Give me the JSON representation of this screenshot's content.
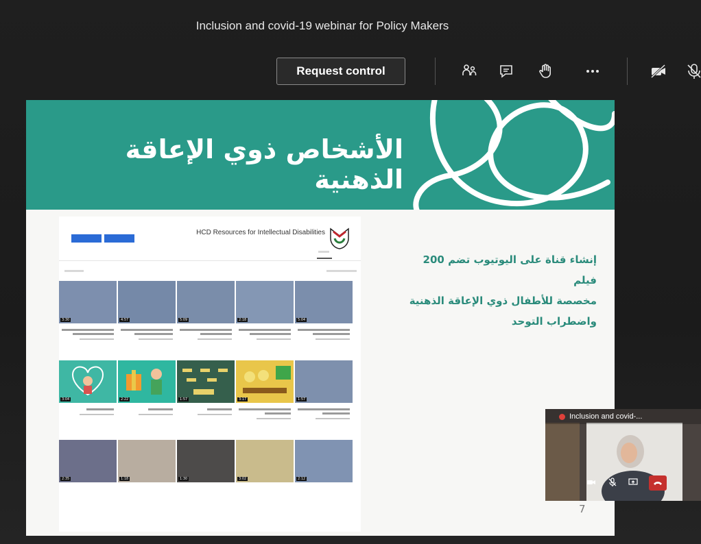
{
  "meeting": {
    "title": "Inclusion and covid-19 webinar for Policy Makers"
  },
  "toolbar": {
    "request_control_label": "Request control",
    "icons": [
      "participants-icon",
      "chat-icon",
      "raise-hand-icon",
      "more-options-icon",
      "camera-off-icon",
      "mic-off-icon"
    ]
  },
  "slide": {
    "title": "الأشخاص ذوي الإعاقة الذهنية",
    "body_lines": [
      "إنشاء قناة على اليوتيوب تضم 200 فيلم",
      "مخصصة للأطفال ذوي الإعاقة الذهنية",
      "واضطراب التوحد"
    ],
    "page_number": "7",
    "accent_color": "#2a9a89"
  },
  "youtube": {
    "channel_name": "HCD Resources for Intellectual Disabilities",
    "subscribe_label": "",
    "durations_row1": [
      "3:30",
      "4:57",
      "5:09",
      "2:18",
      "5:04"
    ],
    "durations_row2": [
      "3:04",
      "2:22",
      "1:57",
      "3:17",
      "1:57"
    ],
    "durations_row3": [
      "2:35",
      "1:18",
      "1:30",
      "3:02",
      "2:12"
    ]
  },
  "self_view": {
    "title": "Inclusion and covid-..."
  }
}
